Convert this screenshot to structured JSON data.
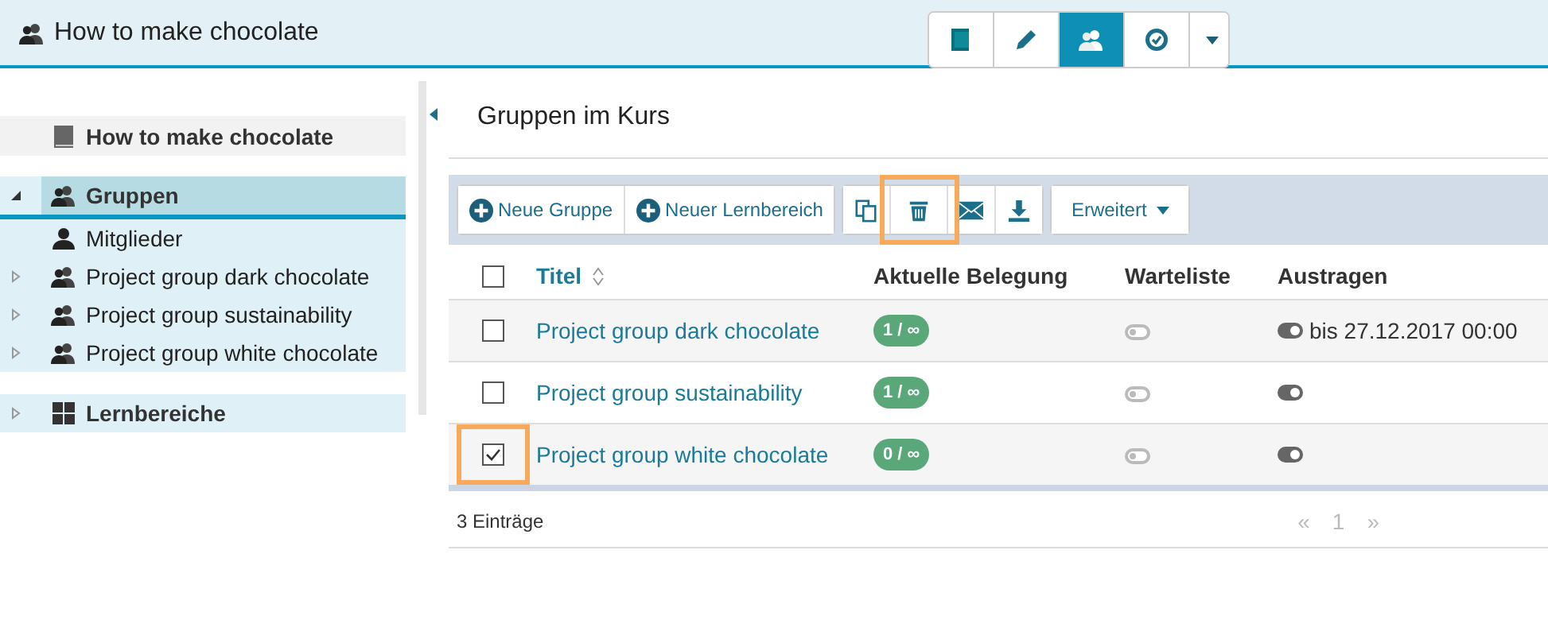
{
  "header": {
    "title": "How to make chocolate",
    "tools": [
      {
        "kind": "book",
        "selected": false
      },
      {
        "kind": "pencil",
        "selected": false
      },
      {
        "kind": "users",
        "selected": true
      },
      {
        "kind": "badge",
        "selected": false
      },
      {
        "kind": "caret",
        "selected": false
      }
    ]
  },
  "sidebar": {
    "course": "How to make chocolate",
    "sections": [
      {
        "label": "Gruppen",
        "kind": "users",
        "expanded": true,
        "selected": true,
        "children": [
          {
            "label": "Mitglieder",
            "kind": "user",
            "expandable": false
          },
          {
            "label": "Project group dark chocolate",
            "kind": "users",
            "expandable": true
          },
          {
            "label": "Project group sustainability",
            "kind": "users",
            "expandable": true
          },
          {
            "label": "Project group white chocolate",
            "kind": "users",
            "expandable": true
          }
        ]
      },
      {
        "label": "Lernbereiche",
        "kind": "grid",
        "expanded": false,
        "selected": false
      }
    ]
  },
  "main": {
    "heading": "Gruppen im Kurs",
    "toolbar": [
      {
        "group": [
          {
            "kind": "plus",
            "label": "Neue Gruppe",
            "highlighted": false
          },
          {
            "kind": "plus",
            "label": "Neuer Lernbereich",
            "highlighted": false
          }
        ]
      },
      {
        "group": [
          {
            "kind": "copy",
            "highlighted": false
          },
          {
            "kind": "trash",
            "highlighted": true
          },
          {
            "kind": "mail",
            "highlighted": false
          },
          {
            "kind": "download",
            "highlighted": false
          }
        ]
      },
      {
        "group": [
          {
            "kind": "dropdown",
            "label": "Erweitert",
            "highlighted": false
          }
        ]
      }
    ],
    "table": {
      "select_all_checked": false,
      "columns": [
        "Titel",
        "Aktuelle Belegung",
        "Warteliste",
        "Austragen"
      ],
      "rows": [
        {
          "checked": false,
          "highlighted": false,
          "title": "Project group dark chocolate",
          "occupancy": "1 / ∞",
          "waitlist_on": false,
          "signout_on": true,
          "signout_until": "bis 27.12.2017 00:00"
        },
        {
          "checked": false,
          "highlighted": false,
          "title": "Project group sustainability",
          "occupancy": "1 / ∞",
          "waitlist_on": false,
          "signout_on": true
        },
        {
          "checked": true,
          "highlighted": true,
          "title": "Project group white chocolate",
          "occupancy": "0 / ∞",
          "waitlist_on": false,
          "signout_on": true
        }
      ]
    },
    "footer": {
      "count": "3 Einträge",
      "pager": [
        "«",
        "1",
        "»"
      ]
    }
  }
}
